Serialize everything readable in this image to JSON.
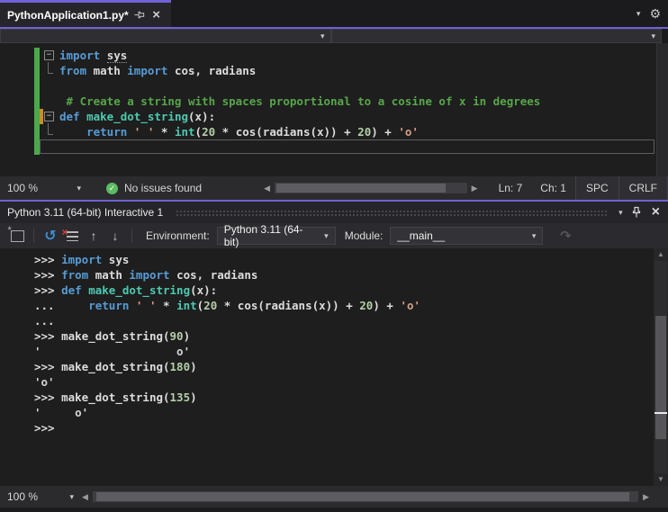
{
  "accent_color": "#6f62d4",
  "icons": {
    "chevron_down": "▾",
    "gear": "⚙",
    "close": "×",
    "reset": "↺",
    "clear_x": "×",
    "history_prev": "↑",
    "history_next": "↓",
    "redo": "↷",
    "scroll_left": "◀",
    "scroll_right": "▶",
    "scroll_up": "▲",
    "scroll_down": "▼",
    "check": "✓",
    "fold_collapse": "−",
    "star": "*"
  },
  "editor_tab": {
    "title": "PythonApplication1.py*"
  },
  "editor": {
    "lines": [
      {
        "m": "g",
        "fold": true,
        "tokens": [
          [
            "kw",
            "import "
          ],
          [
            "du",
            "sys"
          ]
        ]
      },
      {
        "m": "g",
        "guide": true,
        "tokens": [
          [
            "kw",
            "from "
          ],
          [
            "pl",
            "math "
          ],
          [
            "kw",
            "import "
          ],
          [
            "pl",
            "cos, radians"
          ]
        ]
      },
      {
        "m": "g",
        "tokens": []
      },
      {
        "m": "g",
        "tokens": [
          [
            "com",
            " # Create a string with spaces proportional to a cosine of x in degrees"
          ]
        ]
      },
      {
        "m": "go",
        "fold": true,
        "tokens": [
          [
            "kw",
            "def "
          ],
          [
            "fn",
            "make_dot_string"
          ],
          [
            "pl",
            "(x):"
          ]
        ]
      },
      {
        "m": "g",
        "guide": true,
        "tokens": [
          [
            "ws",
            "    "
          ],
          [
            "kw",
            "return "
          ],
          [
            "str",
            "' '"
          ],
          [
            "pl",
            " * "
          ],
          [
            "fn",
            "int"
          ],
          [
            "pl",
            "("
          ],
          [
            "num",
            "20"
          ],
          [
            "pl",
            " * cos(radians(x)) + "
          ],
          [
            "num",
            "20"
          ],
          [
            "pl",
            ") + "
          ],
          [
            "str",
            "'o'"
          ]
        ]
      },
      {
        "m": "g",
        "caret": true,
        "tokens": []
      }
    ],
    "status": {
      "zoom": "100 %",
      "message": "No issues found",
      "line": "Ln: 7",
      "column": "Ch: 1",
      "indent_mode": "SPC",
      "line_ending": "CRLF"
    }
  },
  "interactive": {
    "title": "Python 3.11 (64-bit) Interactive 1",
    "toolbar": {
      "environment_label": "Environment:",
      "environment_value": "Python 3.11 (64-bit)",
      "module_label": "Module:",
      "module_value": "__main__"
    },
    "lines": [
      {
        "tokens": [
          [
            "prompt",
            ">>> "
          ],
          [
            "kw",
            "import "
          ],
          [
            "pl",
            "sys"
          ]
        ]
      },
      {
        "tokens": [
          [
            "prompt",
            ">>> "
          ],
          [
            "kw",
            "from "
          ],
          [
            "pl",
            "math "
          ],
          [
            "kw",
            "import "
          ],
          [
            "pl",
            "cos, radians"
          ]
        ]
      },
      {
        "tokens": [
          [
            "prompt",
            ">>> "
          ],
          [
            "kw",
            "def "
          ],
          [
            "fn",
            "make_dot_string"
          ],
          [
            "pl",
            "(x):"
          ]
        ]
      },
      {
        "tokens": [
          [
            "prompt",
            "... "
          ],
          [
            "ws",
            "    "
          ],
          [
            "kw",
            "return "
          ],
          [
            "str",
            "' '"
          ],
          [
            "pl",
            " * "
          ],
          [
            "fn",
            "int"
          ],
          [
            "pl",
            "("
          ],
          [
            "num",
            "20"
          ],
          [
            "pl",
            " * cos(radians(x)) + "
          ],
          [
            "num",
            "20"
          ],
          [
            "pl",
            ") + "
          ],
          [
            "str",
            "'o'"
          ]
        ]
      },
      {
        "tokens": [
          [
            "prompt",
            "..."
          ]
        ]
      },
      {
        "tokens": [
          [
            "prompt",
            ">>> "
          ],
          [
            "pl",
            "make_dot_string("
          ],
          [
            "num",
            "90"
          ],
          [
            "pl",
            ")"
          ]
        ]
      },
      {
        "tokens": [
          [
            "out",
            "'                    o'"
          ]
        ]
      },
      {
        "tokens": [
          [
            "prompt",
            ">>> "
          ],
          [
            "pl",
            "make_dot_string("
          ],
          [
            "num",
            "180"
          ],
          [
            "pl",
            ")"
          ]
        ]
      },
      {
        "tokens": [
          [
            "out",
            "'o'"
          ]
        ]
      },
      {
        "tokens": [
          [
            "prompt",
            ">>> "
          ],
          [
            "pl",
            "make_dot_string("
          ],
          [
            "num",
            "135"
          ],
          [
            "pl",
            ")"
          ]
        ]
      },
      {
        "tokens": [
          [
            "out",
            "'     o'"
          ]
        ]
      },
      {
        "tokens": [
          [
            "prompt",
            ">>>"
          ]
        ]
      }
    ],
    "status": {
      "zoom": "100 %"
    }
  }
}
